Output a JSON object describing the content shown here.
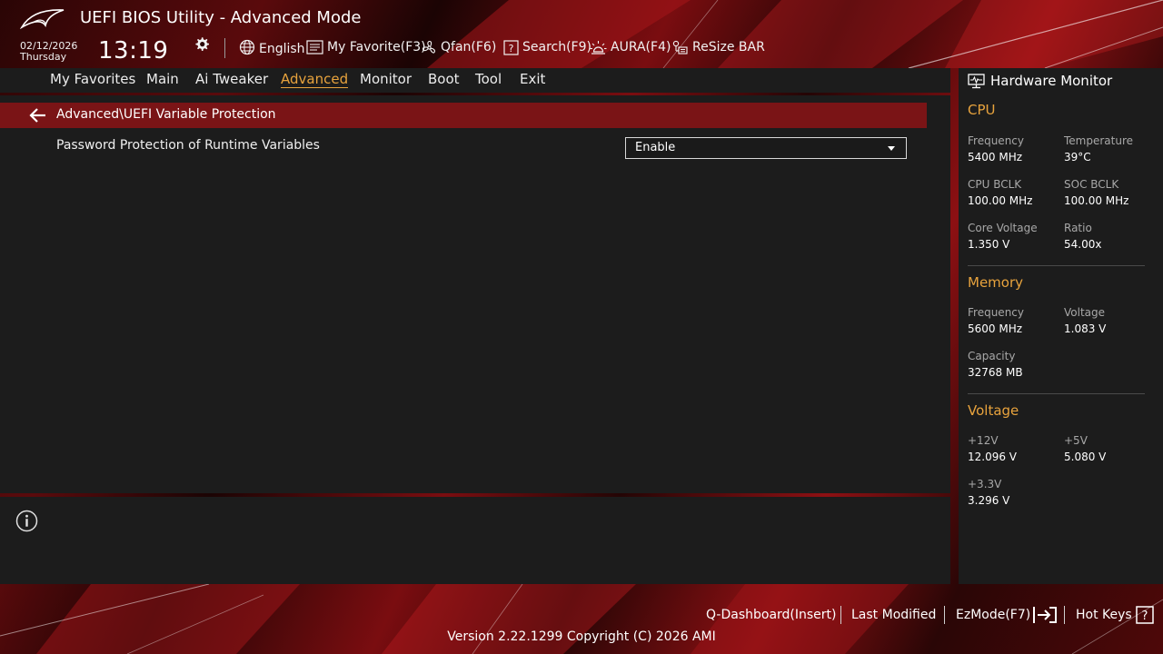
{
  "header": {
    "title": "UEFI BIOS Utility - Advanced Mode",
    "date": "02/12/2026",
    "weekday": "Thursday",
    "time": "13:19",
    "buttons": {
      "language": "English",
      "my_favorite": "My Favorite(F3)",
      "qfan": "Qfan(F6)",
      "search": "Search(F9)",
      "aura": "AURA(F4)",
      "resize_bar": "ReSize BAR"
    }
  },
  "nav": {
    "tabs": [
      "My Favorites",
      "Main",
      "Ai Tweaker",
      "Advanced",
      "Monitor",
      "Boot",
      "Tool",
      "Exit"
    ],
    "active_tab": "Advanced"
  },
  "main": {
    "breadcrumb": "Advanced\\UEFI Variable Protection",
    "settings": [
      {
        "label": "Password Protection of Runtime Variables",
        "value": "Enable"
      }
    ]
  },
  "hardware_monitor": {
    "title": "Hardware Monitor",
    "cpu": {
      "heading": "CPU",
      "frequency_label": "Frequency",
      "frequency": "5400 MHz",
      "temperature_label": "Temperature",
      "temperature": "39°C",
      "cpu_bclk_label": "CPU BCLK",
      "cpu_bclk": "100.00 MHz",
      "soc_bclk_label": "SOC BCLK",
      "soc_bclk": "100.00 MHz",
      "core_voltage_label": "Core Voltage",
      "core_voltage": "1.350 V",
      "ratio_label": "Ratio",
      "ratio": "54.00x"
    },
    "memory": {
      "heading": "Memory",
      "frequency_label": "Frequency",
      "frequency": "5600 MHz",
      "voltage_label": "Voltage",
      "voltage": "1.083 V",
      "capacity_label": "Capacity",
      "capacity": "32768 MB"
    },
    "voltage": {
      "heading": "Voltage",
      "v12_label": "+12V",
      "v12": "12.096 V",
      "v5_label": "+5V",
      "v5": "5.080 V",
      "v33_label": "+3.3V",
      "v33": "3.296 V"
    }
  },
  "footer": {
    "q_dashboard": "Q-Dashboard(Insert)",
    "last_modified": "Last Modified",
    "ezmode": "EzMode(F7)",
    "hot_keys": "Hot Keys",
    "version": "Version 2.22.1299 Copyright (C) 2026 AMI"
  },
  "colors": {
    "accent": "#e8a33d",
    "breadcrumb_bar": "#7a1416",
    "panel": "#1c1c1c"
  }
}
